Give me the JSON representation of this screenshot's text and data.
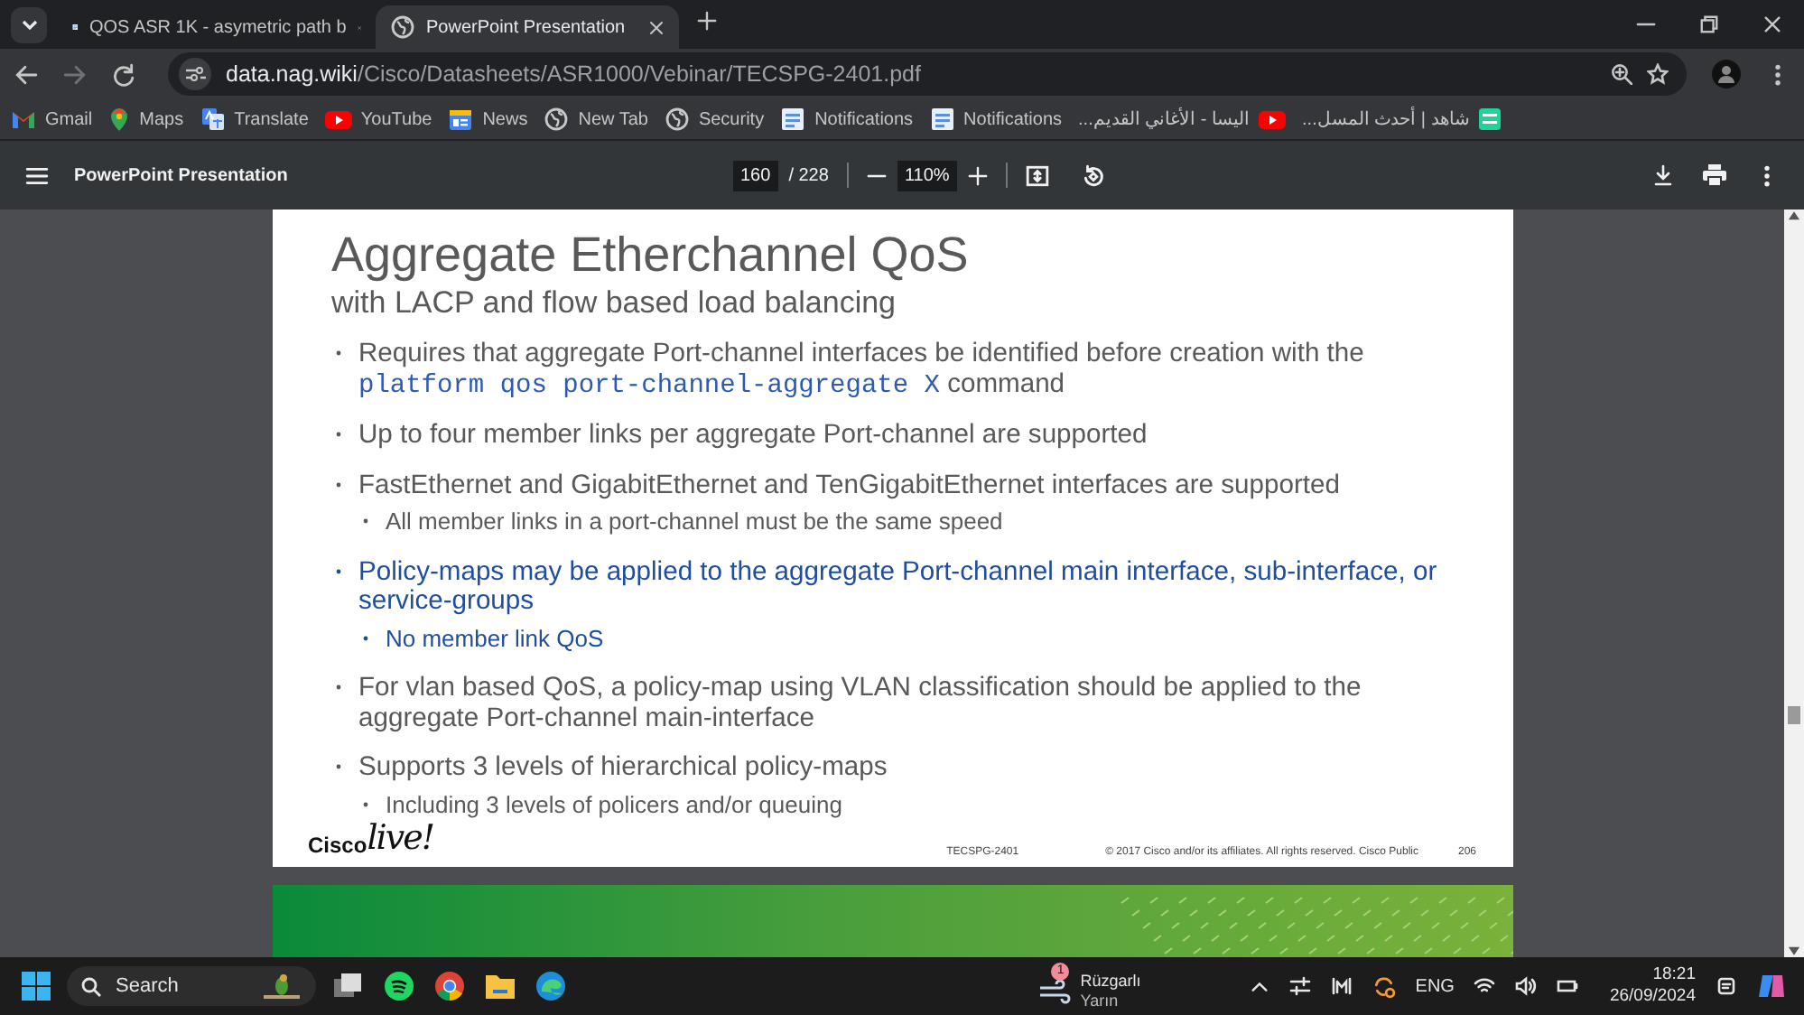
{
  "tabs": [
    {
      "title": "QOS ASR 1K - asymetric path b",
      "kind": "doc",
      "selected": false
    },
    {
      "title": "PowerPoint Presentation",
      "kind": "globe",
      "selected": true
    }
  ],
  "address": {
    "host": "data.nag.wiki",
    "path": "/Cisco/Datasheets/ASR1000/Vebinar/TECSPG-2401.pdf"
  },
  "bookmarks": [
    {
      "label": "Gmail",
      "kind": "gmail"
    },
    {
      "label": "Maps",
      "kind": "maps"
    },
    {
      "label": "Translate",
      "kind": "translate"
    },
    {
      "label": "YouTube",
      "kind": "youtube"
    },
    {
      "label": "News",
      "kind": "news"
    },
    {
      "label": "New Tab",
      "kind": "globe"
    },
    {
      "label": "Security",
      "kind": "globe"
    },
    {
      "label": "Notifications",
      "kind": "doc"
    },
    {
      "label": "Notifications",
      "kind": "doc"
    },
    {
      "label": "اليسا - الأغاني القديم...",
      "kind": "youtube"
    },
    {
      "label": "شاهد | أحدث المسل...",
      "kind": "shahid"
    }
  ],
  "pdf_toolbar": {
    "title": "PowerPoint Presentation",
    "page": "160",
    "total": "/ 228",
    "zoom": "110%"
  },
  "slide": {
    "title": "Aggregate Etherchannel QoS",
    "subtitle": "with LACP and flow based load balancing",
    "bullets": [
      {
        "highlighted": false,
        "parts": [
          {
            "kind": "text",
            "text": "Requires that aggregate Port-channel interfaces be identified before creation with the "
          },
          {
            "kind": "code",
            "text": "platform qos port-channel-aggregate X"
          },
          {
            "kind": "text",
            "text": " command"
          }
        ]
      },
      {
        "highlighted": false,
        "parts": [
          {
            "kind": "text",
            "text": "Up to four member links per aggregate Port-channel are supported"
          }
        ]
      },
      {
        "highlighted": false,
        "parts": [
          {
            "kind": "text",
            "text": "FastEthernet and GigabitEthernet and TenGigabitEthernet interfaces are supported"
          }
        ],
        "children": [
          "All member links in a port-channel must be the same speed"
        ]
      },
      {
        "highlighted": true,
        "parts": [
          {
            "kind": "text",
            "text": "Policy-maps may be applied to the aggregate Port-channel main interface, sub-interface, or service-groups"
          }
        ],
        "children": [
          "No member link QoS"
        ]
      },
      {
        "highlighted": false,
        "parts": [
          {
            "kind": "text",
            "text": "For vlan based QoS, a policy-map using VLAN classification should be applied to the aggregate Port-channel main-interface"
          }
        ]
      },
      {
        "highlighted": false,
        "parts": [
          {
            "kind": "text",
            "text": "Supports 3 levels of hierarchical policy-maps"
          }
        ],
        "children": [
          "Including 3 levels of policers and/or queuing"
        ]
      }
    ],
    "logo": {
      "word": "Cisco",
      "script": "live!"
    },
    "footer": {
      "code": "TECSPG-2401",
      "copyright": "© 2017  Cisco and/or its affiliates. All rights reserved.   Cisco Public",
      "number": "206"
    }
  },
  "taskbar": {
    "search": "Search",
    "weather": {
      "badge": "1",
      "title": "Rüzgarlı",
      "subtitle": "Yarın"
    },
    "language": "ENG",
    "time": "18:21",
    "date": "26/09/2024"
  }
}
